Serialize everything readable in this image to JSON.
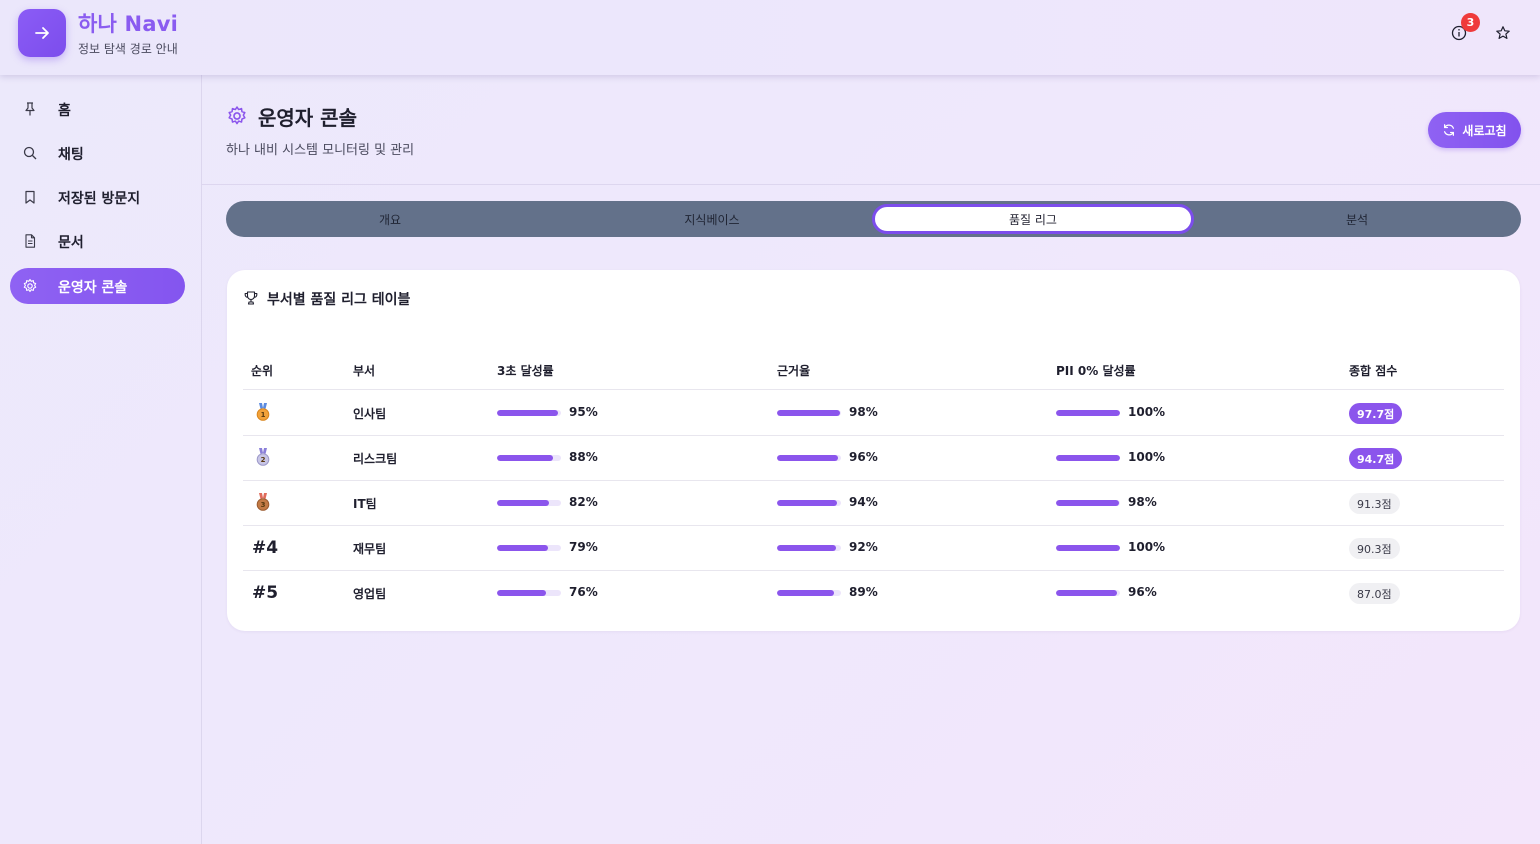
{
  "app": {
    "title": "하나 Navi",
    "subtitle": "정보 탐색 경로 안내",
    "notification_count": "3",
    "accent": "#8b55ec"
  },
  "sidebar": {
    "items": [
      {
        "label": "홈",
        "icon": "pin-icon"
      },
      {
        "label": "채팅",
        "icon": "search-icon"
      },
      {
        "label": "저장된 방문지",
        "icon": "bookmark-icon"
      },
      {
        "label": "문서",
        "icon": "document-icon"
      },
      {
        "label": "운영자 콘솔",
        "icon": "gear-icon",
        "active": true
      }
    ]
  },
  "page": {
    "title": "운영자 콘솔",
    "subtitle": "하나 내비 시스템 모니터링 및 관리",
    "refresh_label": "새로고침"
  },
  "tabs": [
    {
      "label": "개요"
    },
    {
      "label": "지식베이스"
    },
    {
      "label": "품질 리그",
      "active": true
    },
    {
      "label": "분석"
    }
  ],
  "league": {
    "title": "부서별 품질 리그 테이블",
    "columns": [
      "순위",
      "부서",
      "3초 달성률",
      "근거율",
      "PII 0% 달성률",
      "종합 점수"
    ],
    "rows": [
      {
        "rank": "1",
        "medal": "gold",
        "dept": "인사팀",
        "speed": "95%",
        "speed_val": 95,
        "evidence": "98%",
        "evidence_val": 98,
        "pii": "100%",
        "pii_val": 100,
        "score": "97.7점",
        "highlight": true
      },
      {
        "rank": "2",
        "medal": "silver",
        "dept": "리스크팀",
        "speed": "88%",
        "speed_val": 88,
        "evidence": "96%",
        "evidence_val": 96,
        "pii": "100%",
        "pii_val": 100,
        "score": "94.7점",
        "highlight": true
      },
      {
        "rank": "3",
        "medal": "bronze",
        "dept": "IT팀",
        "speed": "82%",
        "speed_val": 82,
        "evidence": "94%",
        "evidence_val": 94,
        "pii": "98%",
        "pii_val": 98,
        "score": "91.3점",
        "highlight": false
      },
      {
        "rank": "#4",
        "medal": "",
        "dept": "재무팀",
        "speed": "79%",
        "speed_val": 79,
        "evidence": "92%",
        "evidence_val": 92,
        "pii": "100%",
        "pii_val": 100,
        "score": "90.3점",
        "highlight": false
      },
      {
        "rank": "#5",
        "medal": "",
        "dept": "영업팀",
        "speed": "76%",
        "speed_val": 76,
        "evidence": "89%",
        "evidence_val": 89,
        "pii": "96%",
        "pii_val": 96,
        "score": "87.0점",
        "highlight": false
      }
    ]
  }
}
